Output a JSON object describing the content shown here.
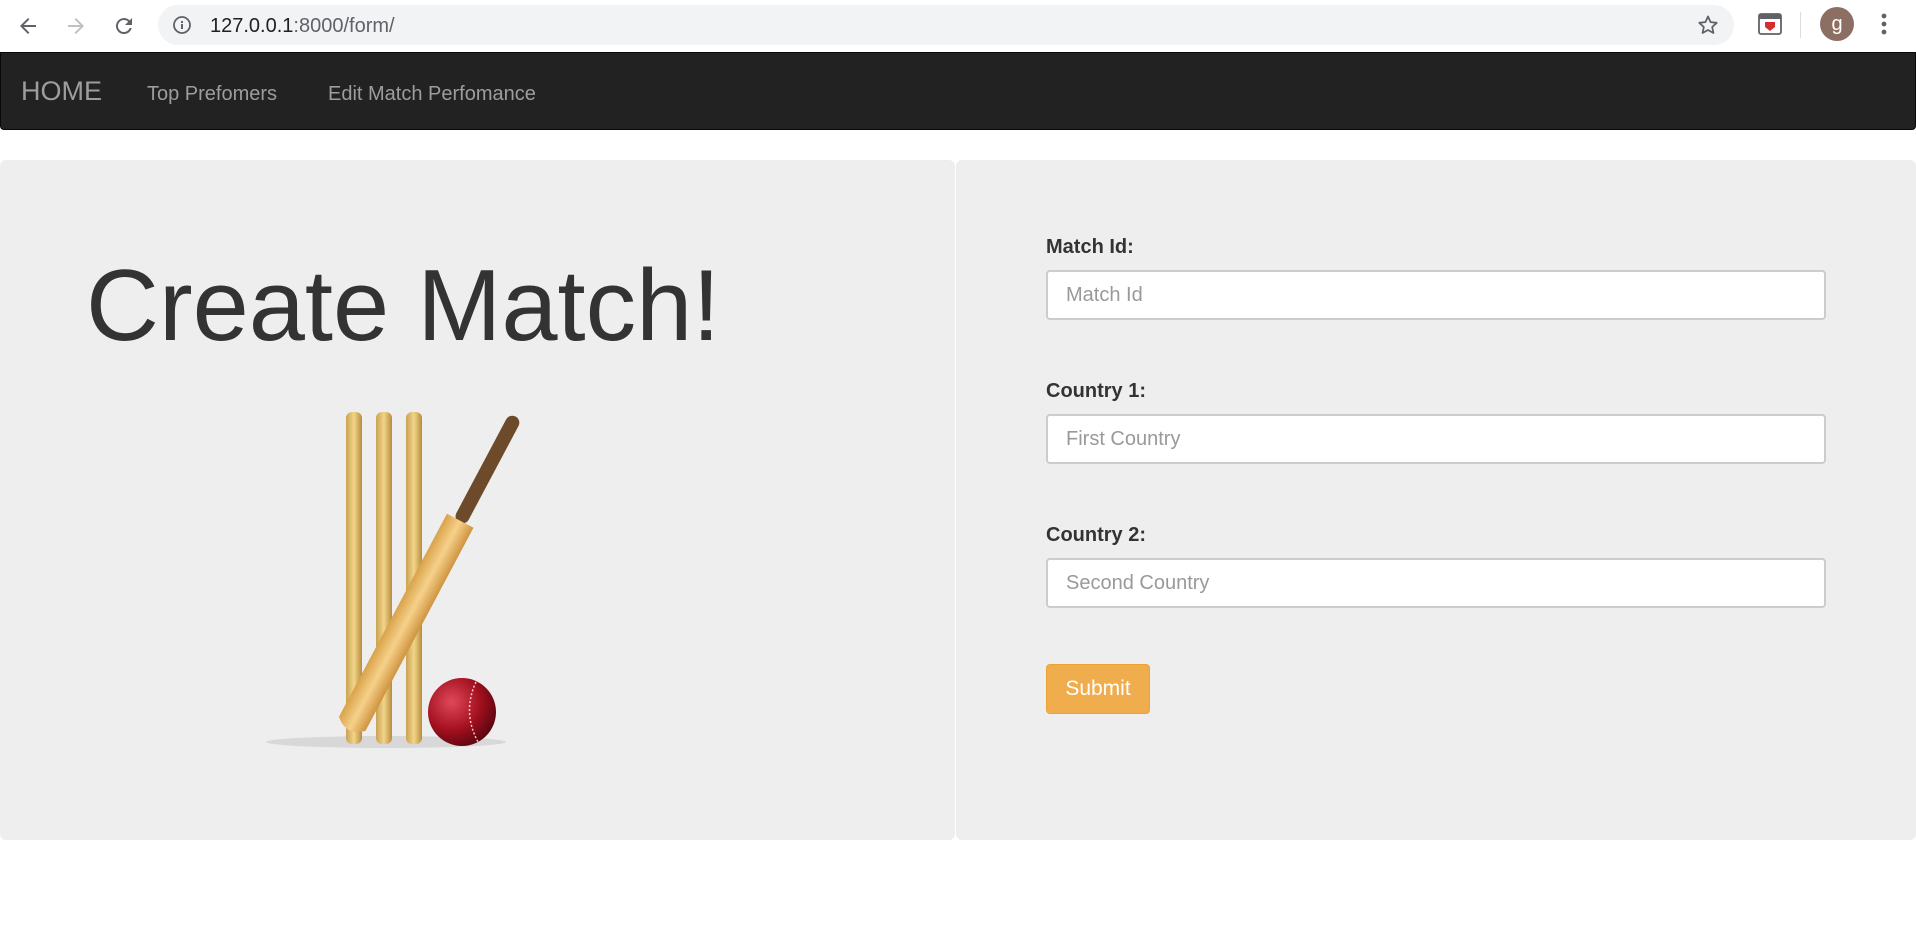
{
  "browser": {
    "url_host": "127.0.0.1",
    "url_path": ":8000/form/",
    "profile_initial": "g"
  },
  "navbar": {
    "brand": "HOME",
    "links": [
      "Top Prefomers",
      "Edit Match Perfomance"
    ]
  },
  "hero": {
    "title": "Create Match!"
  },
  "form": {
    "match_id_label": "Match Id:",
    "match_id_placeholder": "Match Id",
    "country1_label": "Country 1:",
    "country1_placeholder": "First Country",
    "country2_label": "Country 2:",
    "country2_placeholder": "Second Country",
    "submit_label": "Submit"
  },
  "colors": {
    "navbar": "#222222",
    "panel": "#eeeeee",
    "submit": "#f0ad4e"
  }
}
